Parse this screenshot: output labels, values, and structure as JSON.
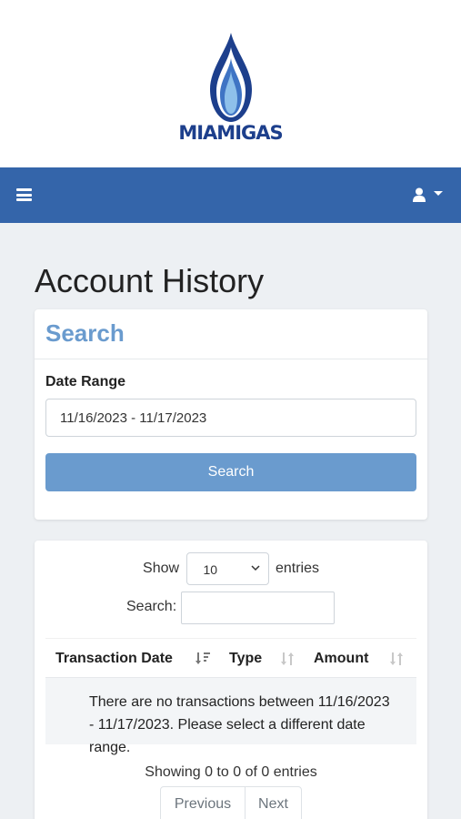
{
  "brand": {
    "name": "MIAMIGAS",
    "colors": {
      "dark_blue": "#1d3f8c",
      "light_blue": "#6fa8de"
    }
  },
  "navbar": {
    "menu_icon": "hamburger-icon",
    "user_icon": "user-icon",
    "background": "#3465aa"
  },
  "page": {
    "title": "Account History"
  },
  "search_card": {
    "title": "Search",
    "date_range_label": "Date Range",
    "date_range_value": "11/16/2023 - 11/17/2023",
    "button_label": "Search",
    "accent": "#6a9bce"
  },
  "table_card": {
    "length": {
      "show_label": "Show",
      "selected": "10",
      "entries_label": "entries"
    },
    "filter": {
      "label": "Search:",
      "value": ""
    },
    "columns": [
      "Transaction Date",
      "Type",
      "Amount"
    ],
    "empty_message": "There are no transactions between 11/16/2023 - 11/17/2023. Please select a different date range.",
    "info": "Showing 0 to 0 of 0 entries",
    "pagination": {
      "previous": "Previous",
      "next": "Next"
    }
  }
}
